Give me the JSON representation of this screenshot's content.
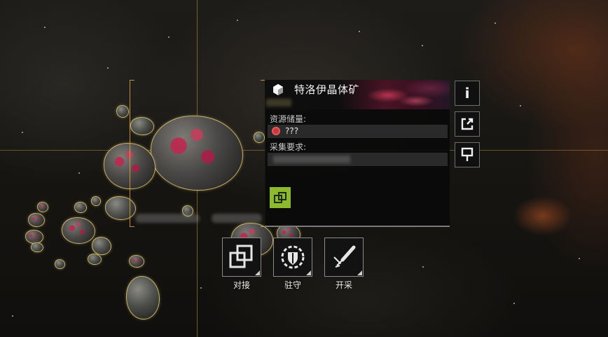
{
  "resource_panel": {
    "title": "特洛伊晶体矿",
    "reserves_label": "资源储量:",
    "reserves_value": "???",
    "requirement_label": "采集要求:"
  },
  "side_buttons": [
    {
      "name": "info",
      "glyph": "i"
    },
    {
      "name": "share",
      "icon": "share-icon"
    },
    {
      "name": "bookmark",
      "icon": "bookmark-icon"
    }
  ],
  "actions": [
    {
      "label": "对接",
      "icon": "dock-icon"
    },
    {
      "label": "驻守",
      "icon": "garrison-icon"
    },
    {
      "label": "开采",
      "icon": "mining-icon"
    }
  ],
  "colors": {
    "dock_chip": "#8cba2c",
    "resource_icon": "#c8383d",
    "selection_bracket": "#dca046"
  }
}
